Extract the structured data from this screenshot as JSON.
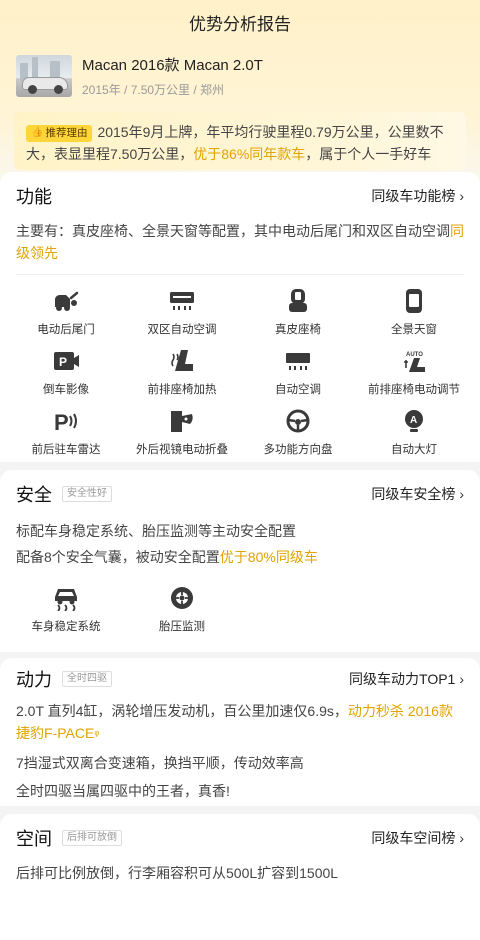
{
  "header": {
    "title": "优势分析报告"
  },
  "car": {
    "name": "Macan 2016款 Macan 2.0T",
    "meta": "2015年 / 7.50万公里 / 郑州"
  },
  "reason": {
    "tag": "推荐理由",
    "text_plain": "2015年9月上牌，年平均行驶里程0.79万公里，公里数不大，表显里程7.50万公里，",
    "text_highlight": "优于86%同年款车",
    "text_tail": "，属于个人一手好车"
  },
  "function": {
    "title": "功能",
    "link": "同级车功能榜",
    "desc_plain": "主要有：真皮座椅、全景天窗等配置，其中电动后尾门和双区自动空调",
    "desc_highlight": "同级领先",
    "features": [
      {
        "label": "电动后尾门",
        "icon": "power-tailgate-icon"
      },
      {
        "label": "双区自动空调",
        "icon": "dual-zone-ac-icon"
      },
      {
        "label": "真皮座椅",
        "icon": "leather-seat-icon"
      },
      {
        "label": "全景天窗",
        "icon": "panoramic-sunroof-icon"
      },
      {
        "label": "倒车影像",
        "icon": "reverse-camera-icon"
      },
      {
        "label": "前排座椅加热",
        "icon": "seat-heating-icon"
      },
      {
        "label": "自动空调",
        "icon": "auto-ac-icon"
      },
      {
        "label": "前排座椅电动调节",
        "icon": "power-seat-adjust-icon"
      },
      {
        "label": "前后驻车雷达",
        "icon": "parking-radar-icon"
      },
      {
        "label": "外后视镜电动折叠",
        "icon": "mirror-fold-icon"
      },
      {
        "label": "多功能方向盘",
        "icon": "steering-wheel-icon"
      },
      {
        "label": "自动大灯",
        "icon": "auto-headlight-icon"
      }
    ]
  },
  "safety": {
    "title": "安全",
    "badge": "安全性好",
    "link": "同级车安全榜",
    "line1": "标配车身稳定系统、胎压监测等主动安全配置",
    "line2_plain": "配备8个安全气囊，被动安全配置",
    "line2_highlight": "优于80%同级车",
    "features": [
      {
        "label": "车身稳定系统",
        "icon": "stability-control-icon"
      },
      {
        "label": "胎压监测",
        "icon": "tire-pressure-icon"
      }
    ]
  },
  "power": {
    "title": "动力",
    "badge": "全时四驱",
    "link": "同级车动力TOP1",
    "line1_plain": "2.0T 直列4缸，涡轮增压发动机，百公里加速仅6.9s，",
    "line1_highlight": "动力秒杀 2016款捷豹F-PACE",
    "line2": "7挡湿式双离合变速箱，换挡平顺，传动效率高",
    "line3": "全时四驱当属四驱中的王者，真香!"
  },
  "space": {
    "title": "空间",
    "badge": "后排可放倒",
    "link": "同级车空间榜",
    "line1": "后排可比例放倒，行李厢容积可从500L扩容到1500L"
  },
  "colors": {
    "accent": "#e0a300",
    "tag_bg": "#ffd63a"
  }
}
